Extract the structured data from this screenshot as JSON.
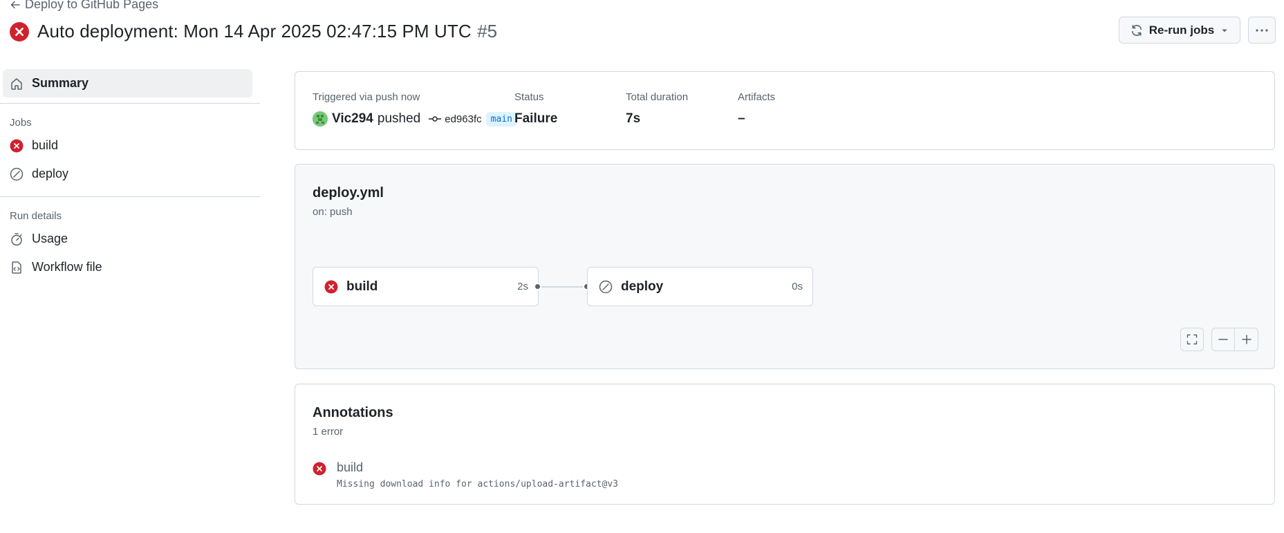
{
  "header": {
    "back_label": "Deploy to GitHub Pages",
    "title": "Auto deployment: Mon 14 Apr 2025 02:47:15 PM UTC",
    "run_number": "#5",
    "rerun_label": "Re-run jobs",
    "status_icon": "x-circle-fill-icon",
    "danger_color": "#cf222e"
  },
  "sidebar": {
    "summary_label": "Summary",
    "jobs_heading": "Jobs",
    "jobs": [
      {
        "label": "build",
        "status": "failure"
      },
      {
        "label": "deploy",
        "status": "skipped"
      }
    ],
    "run_details_heading": "Run details",
    "usage_label": "Usage",
    "workflow_file_label": "Workflow file"
  },
  "summary": {
    "trigger_label": "Triggered via push now",
    "actor": "Vic294",
    "action": "pushed",
    "commit": "ed963fc",
    "branch": "main",
    "status_label": "Status",
    "status_value": "Failure",
    "duration_label": "Total duration",
    "duration_value": "7s",
    "artifacts_label": "Artifacts",
    "artifacts_value": "–"
  },
  "workflow": {
    "file": "deploy.yml",
    "trigger": "on: push",
    "jobs": [
      {
        "name": "build",
        "duration": "2s",
        "status": "failure"
      },
      {
        "name": "deploy",
        "duration": "0s",
        "status": "skipped"
      }
    ]
  },
  "annotations": {
    "title": "Annotations",
    "count_label": "1 error",
    "items": [
      {
        "job": "build",
        "message": "Missing download info for actions/upload-artifact@v3"
      }
    ]
  }
}
